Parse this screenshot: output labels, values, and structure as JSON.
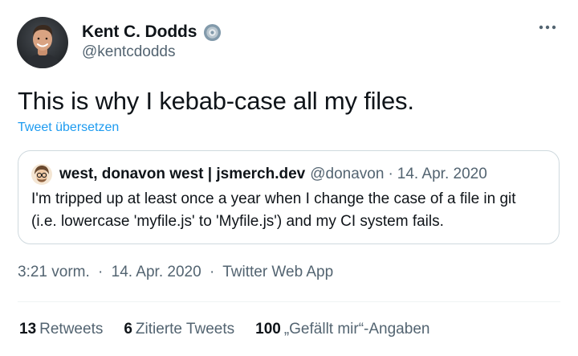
{
  "tweet": {
    "author": {
      "name": "Kent C. Dodds",
      "handle": "@kentcdodds",
      "avatar_icon": "avatar-photo",
      "verified_icon": "verified-badge-icon"
    },
    "text": "This is why I kebab-case all my files.",
    "translate_label": "Tweet übersetzen",
    "quoted": {
      "author_name": "west, donavon west | jsmerch.dev",
      "handle": "@donavon",
      "separator": "·",
      "date": "14. Apr. 2020",
      "text_lines": [
        "I'm tripped up at least once a year when I change the case of a file in git",
        "(i.e. lowercase 'myfile.js' to 'Myfile.js') and my CI system fails."
      ]
    },
    "meta": {
      "time": "3:21 vorm.",
      "separator": "·",
      "date": "14. Apr. 2020",
      "source": "Twitter Web App"
    },
    "stats": {
      "retweets_count": "13",
      "retweets_label": "Retweets",
      "quotes_count": "6",
      "quotes_label": "Zitierte Tweets",
      "likes_count": "100",
      "likes_label": "„Gefällt mir“-Angaben"
    }
  },
  "colors": {
    "text_primary": "#0f1419",
    "text_secondary": "#536471",
    "link": "#1d9bf0",
    "border": "#cfd9de",
    "divider": "#eff3f4"
  }
}
